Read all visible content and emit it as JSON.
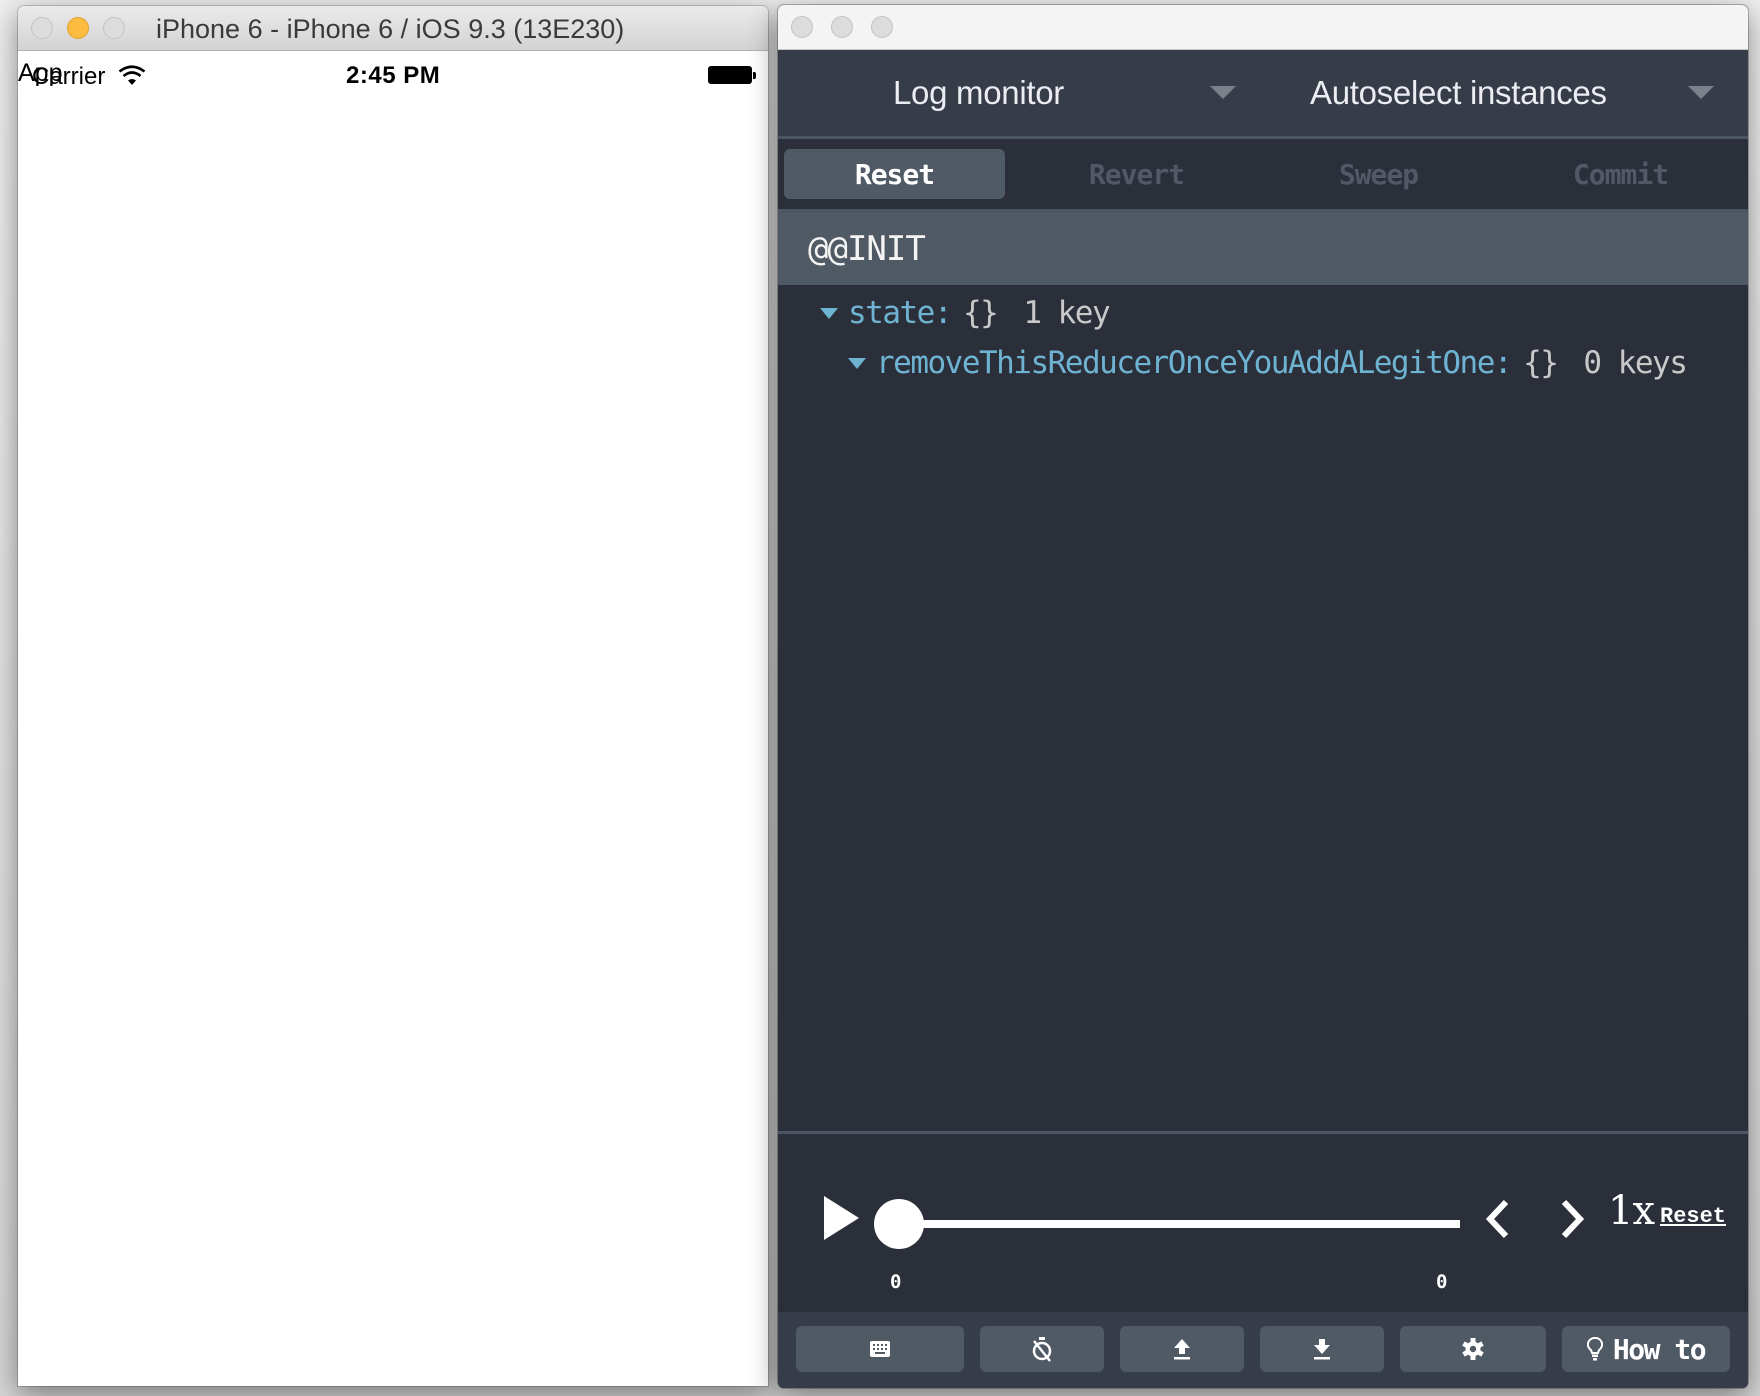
{
  "simulator": {
    "window_title": "iPhone 6 - iPhone 6 / iOS 9.3 (13E230)",
    "status_bar": {
      "app_label": "App",
      "carrier": "Carrier",
      "time": "2:45 PM",
      "battery_level": 1.0
    }
  },
  "devtools": {
    "monitor_select": {
      "selected": "Log monitor"
    },
    "instance_select": {
      "selected": "Autoselect instances"
    },
    "actions": [
      {
        "label": "Reset",
        "active": true
      },
      {
        "label": "Revert",
        "active": false
      },
      {
        "label": "Sweep",
        "active": false
      },
      {
        "label": "Commit",
        "active": false
      }
    ],
    "action_name": "@@INIT",
    "state_tree": [
      {
        "key": "state:",
        "type": "{}",
        "summary": "1 key",
        "depth": 0,
        "expanded": true
      },
      {
        "key": "removeThisReducerOnceYouAddALegitOne:",
        "type": "{}",
        "summary": "0 keys",
        "depth": 1,
        "expanded": true
      }
    ],
    "slider": {
      "current_index": 0,
      "min_label": "0",
      "max_label": "0",
      "position_fraction": 0,
      "speed": "1x",
      "speed_reset_label": "Reset"
    },
    "footer_buttons": [
      {
        "icon": "keyboard-icon",
        "label": ""
      },
      {
        "icon": "stopwatch-off-icon",
        "label": ""
      },
      {
        "icon": "upload-icon",
        "label": ""
      },
      {
        "icon": "download-icon",
        "label": ""
      },
      {
        "icon": "gear-icon",
        "label": ""
      },
      {
        "icon": "lightbulb-icon",
        "label": "How to"
      }
    ],
    "colors": {
      "key": "#6fb3d2",
      "header_bg": "#363c48",
      "panel_bg": "#2a2f3a",
      "accent_bar": "#4f5a65"
    }
  }
}
